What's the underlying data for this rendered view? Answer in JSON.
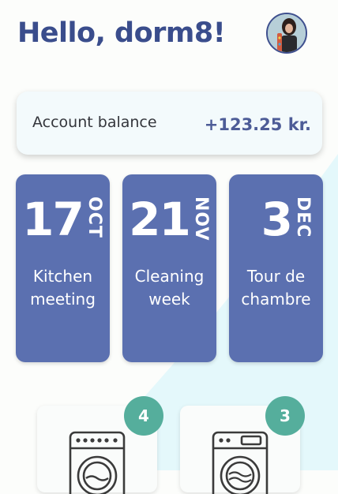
{
  "header": {
    "greeting": "Hello, dorm8!",
    "avatar_icon": "profile-photo"
  },
  "balance": {
    "label": "Account balance",
    "value": "+123.25 kr."
  },
  "events": [
    {
      "day": "17",
      "month": "OCT",
      "title": "Kitchen meeting"
    },
    {
      "day": "21",
      "month": "NOV",
      "title": "Cleaning week"
    },
    {
      "day": "3",
      "month": "DEC",
      "title": "Tour de chambre"
    }
  ],
  "machines": [
    {
      "count": "4",
      "icon": "washing-machine-icon"
    },
    {
      "count": "3",
      "icon": "washing-machine-icon"
    }
  ],
  "colors": {
    "primary": "#3a4d8c",
    "event_card": "#5b70b0",
    "badge": "#55ae9c",
    "background": "#fcfdfb",
    "accent_wave": "#e4f8fb"
  }
}
